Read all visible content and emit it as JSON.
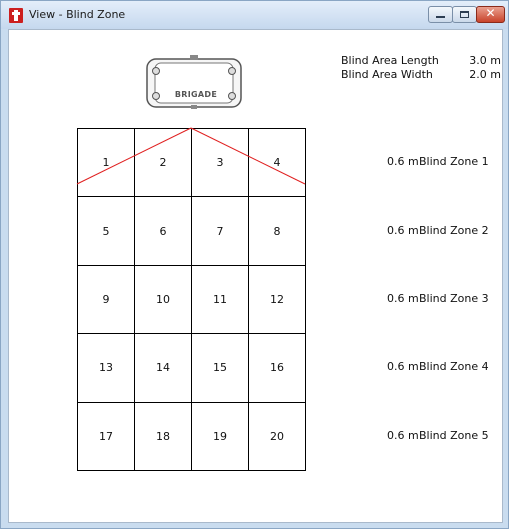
{
  "window": {
    "title": "View - Blind Zone"
  },
  "camera": {
    "brand": "BRIGADE"
  },
  "summary": {
    "length_label": "Blind Area Length",
    "length_value": "3.0 m",
    "width_label": "Blind Area Width",
    "width_value": "2.0 m"
  },
  "grid": {
    "cells": [
      "1",
      "2",
      "3",
      "4",
      "5",
      "6",
      "7",
      "8",
      "9",
      "10",
      "11",
      "12",
      "13",
      "14",
      "15",
      "16",
      "17",
      "18",
      "19",
      "20"
    ]
  },
  "zones": [
    {
      "distance": "0.6 m",
      "name": "Blind Zone 1"
    },
    {
      "distance": "0.6 m",
      "name": "Blind Zone 2"
    },
    {
      "distance": "0.6 m",
      "name": "Blind Zone 3"
    },
    {
      "distance": "0.6 m",
      "name": "Blind Zone 4"
    },
    {
      "distance": "0.6 m",
      "name": "Blind Zone 5"
    }
  ],
  "colors": {
    "blind_zone_line": "#e02020"
  }
}
